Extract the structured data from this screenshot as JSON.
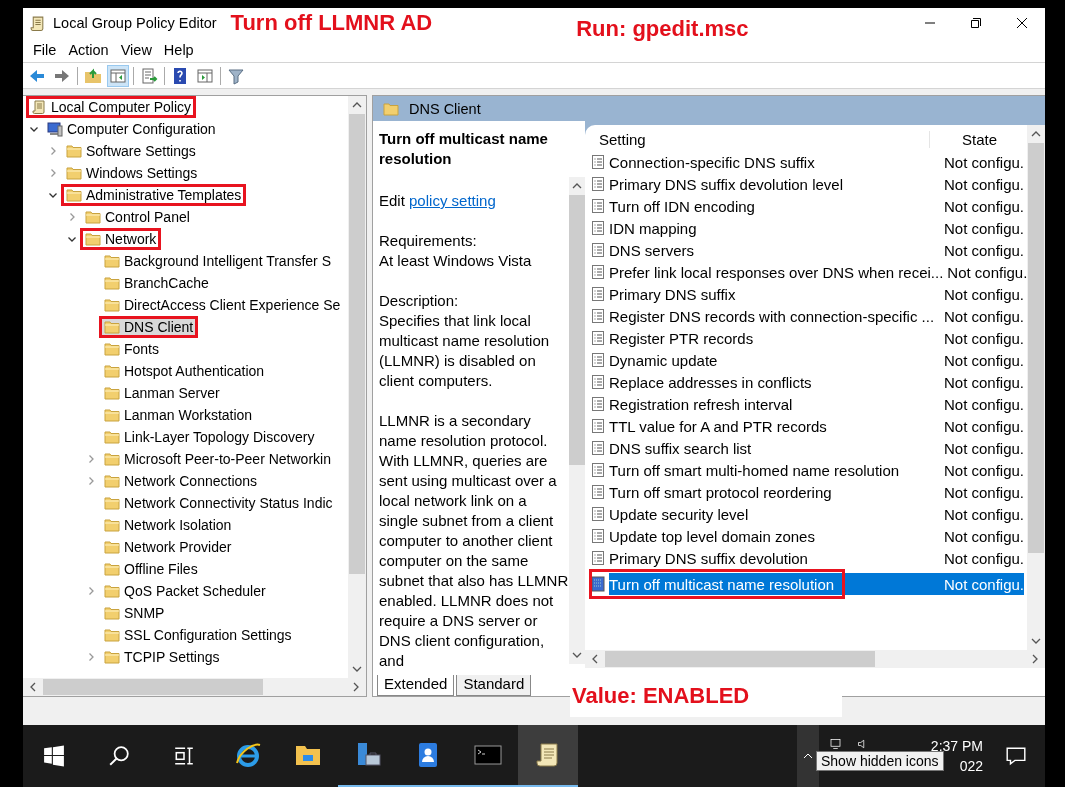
{
  "window": {
    "title": "Local Group Policy Editor"
  },
  "notes": {
    "title_note": "Turn off LLMNR AD",
    "run_note": "Run: gpedit.msc",
    "value_note": "Value: ENABLED"
  },
  "menu": [
    "File",
    "Action",
    "View",
    "Help"
  ],
  "tree": [
    {
      "label": "Local Computer Policy",
      "kind": "root",
      "selected": false,
      "marked": true,
      "children": [
        {
          "label": "Computer Configuration",
          "kind": "computer",
          "has_children": true,
          "expanded": true,
          "selected": false,
          "marked": false,
          "children": [
            {
              "label": "Software Settings",
              "kind": "folder",
              "has_children": true,
              "expanded": false,
              "selected": false,
              "marked": false
            },
            {
              "label": "Windows Settings",
              "kind": "folder",
              "has_children": true,
              "expanded": false,
              "selected": false,
              "marked": false
            },
            {
              "label": "Administrative Templates",
              "kind": "folder",
              "has_children": true,
              "expanded": true,
              "selected": false,
              "marked": true,
              "children": [
                {
                  "label": "Control Panel",
                  "kind": "folder",
                  "has_children": true,
                  "expanded": false,
                  "selected": false,
                  "marked": false
                },
                {
                  "label": "Network",
                  "kind": "folder",
                  "has_children": true,
                  "expanded": true,
                  "selected": false,
                  "marked": true,
                  "children": [
                    {
                      "label": "Background Intelligent Transfer S",
                      "kind": "folder",
                      "has_children": false,
                      "selected": false,
                      "marked": false
                    },
                    {
                      "label": "BranchCache",
                      "kind": "folder",
                      "has_children": false,
                      "selected": false,
                      "marked": false
                    },
                    {
                      "label": "DirectAccess Client Experience Se",
                      "kind": "folder",
                      "has_children": false,
                      "selected": false,
                      "marked": false
                    },
                    {
                      "label": "DNS Client",
                      "kind": "folder",
                      "has_children": false,
                      "selected": true,
                      "marked": true
                    },
                    {
                      "label": "Fonts",
                      "kind": "folder",
                      "has_children": false,
                      "selected": false,
                      "marked": false
                    },
                    {
                      "label": "Hotspot Authentication",
                      "kind": "folder",
                      "has_children": false,
                      "selected": false,
                      "marked": false
                    },
                    {
                      "label": "Lanman Server",
                      "kind": "folder",
                      "has_children": false,
                      "selected": false,
                      "marked": false
                    },
                    {
                      "label": "Lanman Workstation",
                      "kind": "folder",
                      "has_children": false,
                      "selected": false,
                      "marked": false
                    },
                    {
                      "label": "Link-Layer Topology Discovery",
                      "kind": "folder",
                      "has_children": false,
                      "selected": false,
                      "marked": false
                    },
                    {
                      "label": "Microsoft Peer-to-Peer Networkin",
                      "kind": "folder",
                      "has_children": true,
                      "expanded": false,
                      "selected": false,
                      "marked": false
                    },
                    {
                      "label": "Network Connections",
                      "kind": "folder",
                      "has_children": true,
                      "expanded": false,
                      "selected": false,
                      "marked": false
                    },
                    {
                      "label": "Network Connectivity Status Indic",
                      "kind": "folder",
                      "has_children": false,
                      "selected": false,
                      "marked": false
                    },
                    {
                      "label": "Network Isolation",
                      "kind": "folder",
                      "has_children": false,
                      "selected": false,
                      "marked": false
                    },
                    {
                      "label": "Network Provider",
                      "kind": "folder",
                      "has_children": false,
                      "selected": false,
                      "marked": false
                    },
                    {
                      "label": "Offline Files",
                      "kind": "folder",
                      "has_children": false,
                      "selected": false,
                      "marked": false
                    },
                    {
                      "label": "QoS Packet Scheduler",
                      "kind": "folder",
                      "has_children": true,
                      "expanded": false,
                      "selected": false,
                      "marked": false
                    },
                    {
                      "label": "SNMP",
                      "kind": "folder",
                      "has_children": false,
                      "selected": false,
                      "marked": false
                    },
                    {
                      "label": "SSL Configuration Settings",
                      "kind": "folder",
                      "has_children": false,
                      "selected": false,
                      "marked": false
                    },
                    {
                      "label": "TCPIP Settings",
                      "kind": "folder",
                      "has_children": true,
                      "expanded": false,
                      "selected": false,
                      "marked": false
                    }
                  ]
                }
              ]
            }
          ]
        }
      ]
    }
  ],
  "details": {
    "header": "DNS Client",
    "policy_title": "Turn off multicast name resolution",
    "edit_prefix": "Edit",
    "edit_link": "policy setting",
    "requirements_label": "Requirements:",
    "requirements": "At least Windows Vista",
    "description_label": "Description:",
    "paragraphs": [
      "Specifies that link local multicast name resolution (LLMNR) is disabled on client computers.",
      "LLMNR is a secondary name resolution protocol. With LLMNR, queries are sent using multicast over a local network link on a single subnet from a client computer to another client computer on the same subnet that also has LLMNR enabled. LLMNR does not require a DNS server or DNS client configuration, and"
    ],
    "tabs": [
      {
        "label": "Extended",
        "selected": true
      },
      {
        "label": "Standard",
        "selected": false
      }
    ]
  },
  "settings": {
    "columns": [
      "Setting",
      "State"
    ],
    "rows": [
      {
        "name": "Connection-specific DNS suffix",
        "state": "Not configu.",
        "selected": false,
        "marked": false
      },
      {
        "name": "Primary DNS suffix devolution level",
        "state": "Not configu.",
        "selected": false,
        "marked": false
      },
      {
        "name": "Turn off IDN encoding",
        "state": "Not configu.",
        "selected": false,
        "marked": false
      },
      {
        "name": "IDN mapping",
        "state": "Not configu.",
        "selected": false,
        "marked": false
      },
      {
        "name": "DNS servers",
        "state": "Not configu.",
        "selected": false,
        "marked": false
      },
      {
        "name": "Prefer link local responses over DNS when recei...",
        "state": "Not configu.",
        "selected": false,
        "marked": false
      },
      {
        "name": "Primary DNS suffix",
        "state": "Not configu.",
        "selected": false,
        "marked": false
      },
      {
        "name": "Register DNS records with connection-specific ...",
        "state": "Not configu.",
        "selected": false,
        "marked": false
      },
      {
        "name": "Register PTR records",
        "state": "Not configu.",
        "selected": false,
        "marked": false
      },
      {
        "name": "Dynamic update",
        "state": "Not configu.",
        "selected": false,
        "marked": false
      },
      {
        "name": "Replace addresses in conflicts",
        "state": "Not configu.",
        "selected": false,
        "marked": false
      },
      {
        "name": "Registration refresh interval",
        "state": "Not configu.",
        "selected": false,
        "marked": false
      },
      {
        "name": "TTL value for A and PTR records",
        "state": "Not configu.",
        "selected": false,
        "marked": false
      },
      {
        "name": "DNS suffix search list",
        "state": "Not configu.",
        "selected": false,
        "marked": false
      },
      {
        "name": "Turn off smart multi-homed name resolution",
        "state": "Not configu.",
        "selected": false,
        "marked": false
      },
      {
        "name": "Turn off smart protocol reordering",
        "state": "Not configu.",
        "selected": false,
        "marked": false
      },
      {
        "name": "Update security level",
        "state": "Not configu.",
        "selected": false,
        "marked": false
      },
      {
        "name": "Update top level domain zones",
        "state": "Not configu.",
        "selected": false,
        "marked": false
      },
      {
        "name": "Primary DNS suffix devolution",
        "state": "Not configu.",
        "selected": false,
        "marked": false
      },
      {
        "name": "Turn off multicast name resolution",
        "state": "Not configu.",
        "selected": true,
        "marked": true
      }
    ]
  },
  "taskbar": {
    "apps": [
      {
        "kind": "browser",
        "running": false,
        "selected": false
      },
      {
        "kind": "explorer",
        "running": false,
        "selected": false
      },
      {
        "kind": "server",
        "running": true,
        "selected": false
      },
      {
        "kind": "contacts",
        "running": true,
        "selected": false
      },
      {
        "kind": "terminal",
        "running": true,
        "selected": false
      },
      {
        "kind": "scroll",
        "running": true,
        "selected": true
      }
    ],
    "time": "2:37 PM",
    "date": "022",
    "tooltip": "Show hidden icons"
  }
}
